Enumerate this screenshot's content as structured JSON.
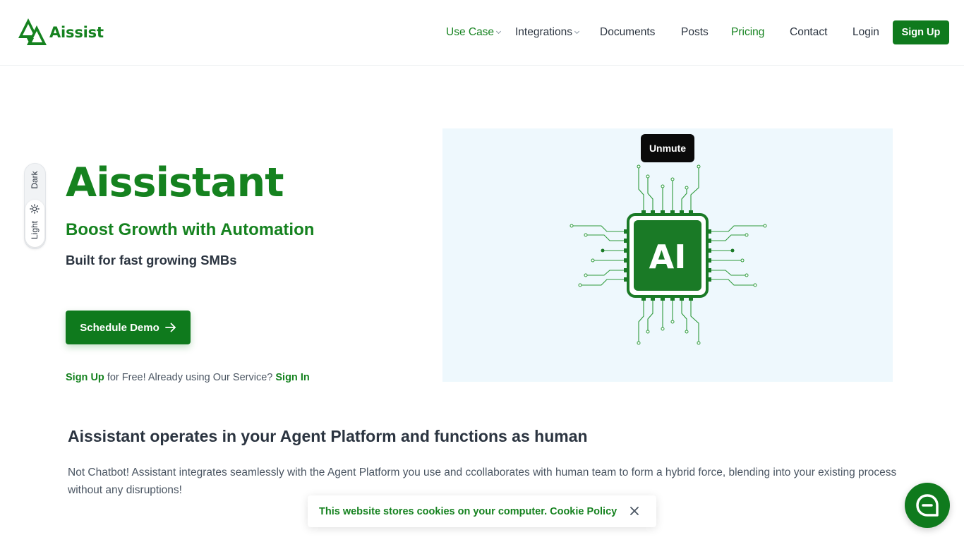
{
  "brand": {
    "name": "Aissist",
    "color": "#15821f",
    "button_color": "#0f7a1d"
  },
  "nav": {
    "items": [
      {
        "label": "Use Case",
        "has_dropdown": true,
        "active": true
      },
      {
        "label": "Integrations",
        "has_dropdown": true,
        "active": false
      },
      {
        "label": "Documents",
        "has_dropdown": false,
        "active": false
      },
      {
        "label": "Posts",
        "has_dropdown": false,
        "active": false
      },
      {
        "label": "Pricing",
        "has_dropdown": false,
        "active": true
      },
      {
        "label": "Contact",
        "has_dropdown": false,
        "active": false
      },
      {
        "label": "Login",
        "has_dropdown": false,
        "active": false
      }
    ],
    "signup_label": "Sign Up"
  },
  "theme_toggle": {
    "dark_label": "Dark",
    "light_label": "Light",
    "selected": "Light"
  },
  "hero": {
    "title": "Aissistant",
    "subtitle": "Boost Growth with Automation",
    "tagline": "Built for fast growing SMBs",
    "demo_button": "Schedule Demo",
    "signup_link": "Sign Up",
    "signup_middle": "for Free! Already using Our Service?",
    "signin_link": "Sign In"
  },
  "media": {
    "unmute_label": "Unmute",
    "chip_text": "AI"
  },
  "section": {
    "title": "Aissistant operates in your Agent Platform and functions as human",
    "text": "Not Chatbot! Assistant integrates seamlessly with the Agent Platform you use and ccollaborates with human team to form a hybrid force, blending into your existing process without any disruptions!"
  },
  "cookie": {
    "text": "This website stores cookies on your computer.",
    "link": "Cookie Policy"
  },
  "icons": [
    "logo-icon",
    "chevron-down-icon",
    "sun-icon",
    "arrow-right-icon",
    "close-icon",
    "chat-icon",
    "ai-chip-icon"
  ]
}
